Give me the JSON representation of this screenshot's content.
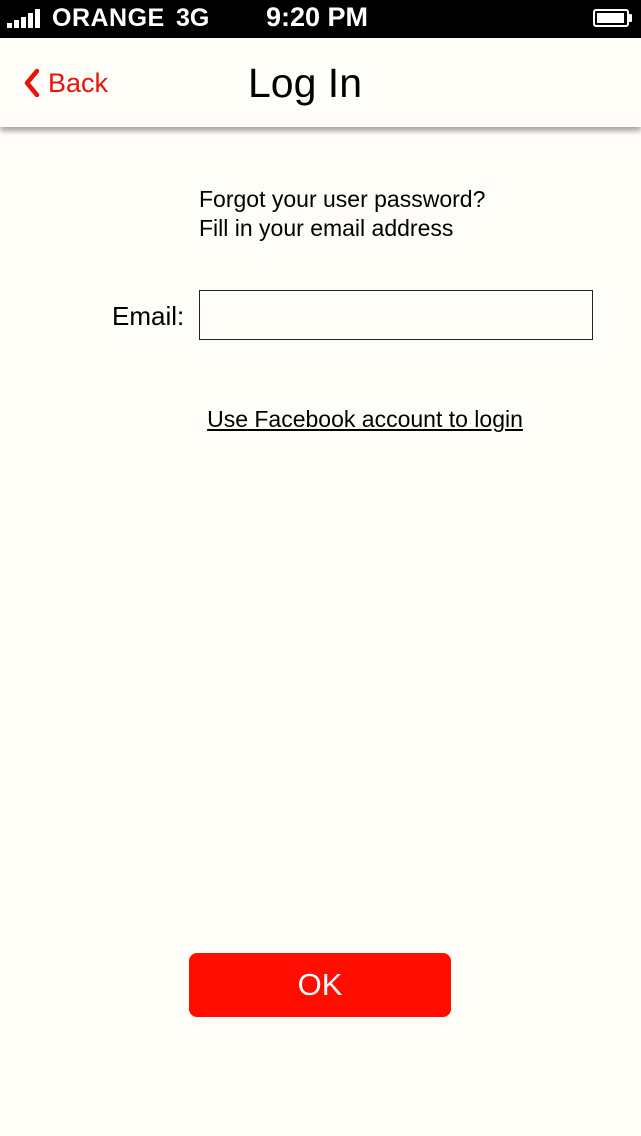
{
  "status_bar": {
    "carrier": "ORANGE",
    "network": "3G",
    "time": "9:20 PM",
    "signal_bars": 5,
    "battery_level": 0.95
  },
  "nav": {
    "back_label": "Back",
    "title": "Log In",
    "accent_color": "#e8140a"
  },
  "form": {
    "instructions_line1": "Forgot your user password?",
    "instructions_line2": "Fill in your email address",
    "email_label": "Email:",
    "email_value": "",
    "facebook_link": "Use Facebook account to login"
  },
  "actions": {
    "ok_label": "OK",
    "ok_color": "#ff0d00"
  }
}
